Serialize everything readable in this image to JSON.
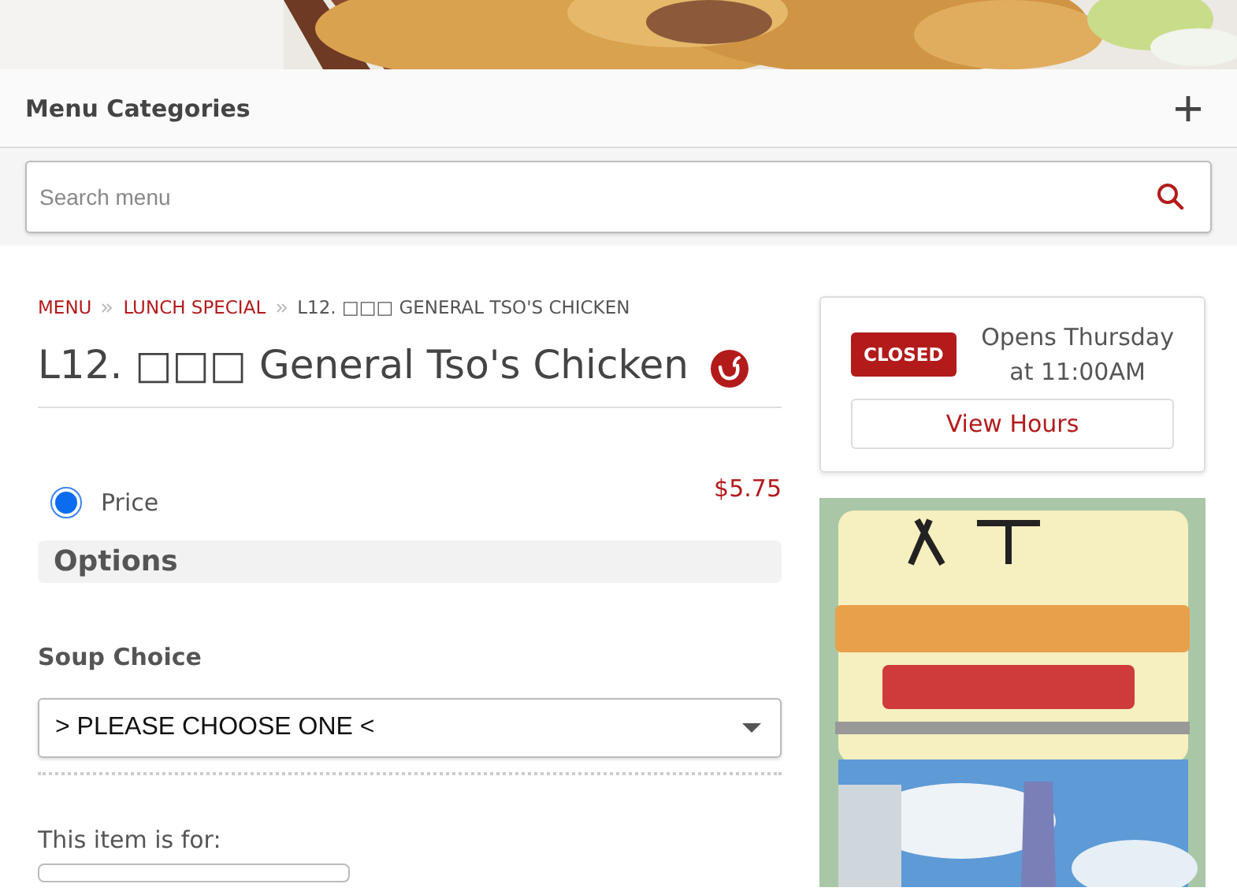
{
  "menu_categories": {
    "title": "Menu Categories",
    "expanded": false
  },
  "search": {
    "placeholder": "Search menu"
  },
  "breadcrumbs": [
    {
      "label": "MENU",
      "link": true
    },
    {
      "label": "LUNCH SPECIAL",
      "link": true
    },
    {
      "label": "L12. □□□ GENERAL TSO'S CHICKEN",
      "link": false
    }
  ],
  "item": {
    "title": "L12. □□□ General Tso's Chicken",
    "spicy": true
  },
  "prices": [
    {
      "label": "Price",
      "price": "$5.75",
      "selected": true
    }
  ],
  "options_heading": "Options",
  "soup_choice": {
    "label": "Soup Choice",
    "value": "> PLEASE CHOOSE ONE <"
  },
  "item_for": {
    "label": "This item is for:"
  },
  "hours": {
    "status": "CLOSED",
    "line_1": "Opens Thursday",
    "line_2": "at 11:00AM",
    "button": "View Hours"
  }
}
